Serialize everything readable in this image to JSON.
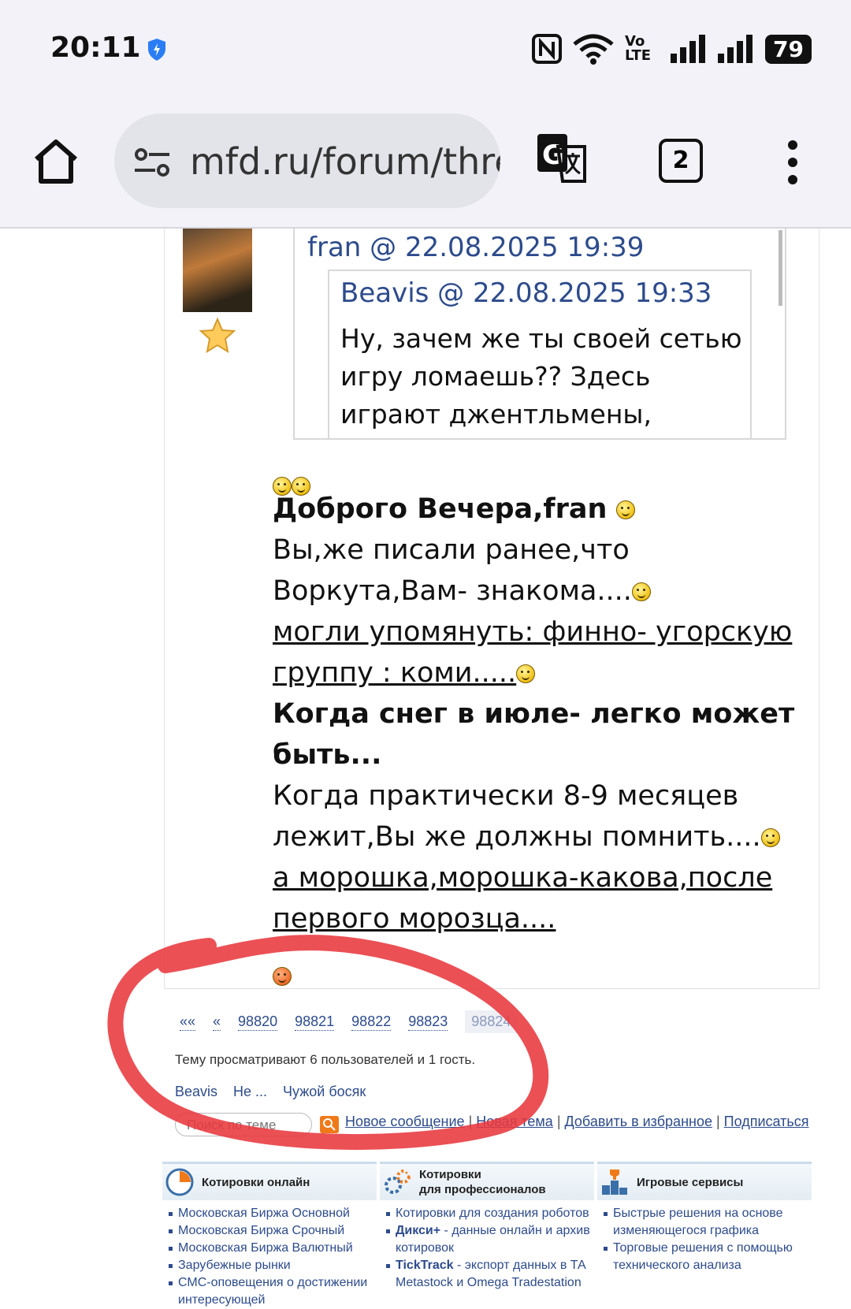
{
  "status_bar": {
    "time": "20:11",
    "volte": "Vo LTE",
    "battery": "79"
  },
  "browser": {
    "url": "mfd.ru/forum/thre",
    "tab_count": "2"
  },
  "post": {
    "outer_quote": {
      "author_line": "fran @ 22.08.2025 19:39"
    },
    "inner_quote": {
      "author_line": "Beavis @ 22.08.2025 19:33",
      "text": "Ну, зачем же ты своей сетью игру ломаешь?? Здесь играют джентльмены, думают головой"
    },
    "lines": {
      "greeting": "Доброго Вечера,fran",
      "l1": "Вы,же писали ранее,что Воркута,Вам- знакома....",
      "l2": "могли упомянуть: финно- угорскую группу : коми.....",
      "l3": "Когда снег в июле- легко может быть...",
      "l4": "Когда практически 8-9 месяцев лежит,Вы же должны помнить....",
      "l5": "а морошка,морошка-какова,после первого морозца...."
    }
  },
  "pager": {
    "first": "««",
    "prev": "«",
    "pages": [
      "98820",
      "98821",
      "98822",
      "98823"
    ],
    "current": "98824"
  },
  "viewing_text": "Тему просматривают 6 пользователей и 1 гость.",
  "viewers": [
    "Beavis",
    "Не ...",
    "Чужой босяк"
  ],
  "search_placeholder": "Поиск по теме",
  "actions": {
    "new_message": "Новое сообщение",
    "new_topic": "Новая тема",
    "add_favorite": "Добавить в избранное",
    "subscribe": "Подписаться"
  },
  "footer": {
    "col1": {
      "title": "Котировки онлайн",
      "items": [
        "Московская Биржа Основной",
        "Московская Биржа Срочный",
        "Московская Биржа Валютный",
        "Зарубежные рынки",
        "СМС-оповещения о достижении интересующей"
      ]
    },
    "col2": {
      "title_line1": "Котировки",
      "title_line2": "для профессионалов",
      "item1": "Котировки для создания роботов",
      "item2_bold": "Дикси+",
      "item2_rest": " - данные онлайн и архив котировок",
      "item3_bold": "TickTrack",
      "item3_rest": " - экспорт данных в ТА Metastock и Omega Tradestation"
    },
    "col3": {
      "title": "Игровые сервисы",
      "items": [
        "Быстрые решения на основе изменяющегося графика",
        "Торговые решения с помощью технического анализа"
      ]
    }
  },
  "colors": {
    "link": "#2d4b8c",
    "annotation_circle": "#e8383d"
  }
}
